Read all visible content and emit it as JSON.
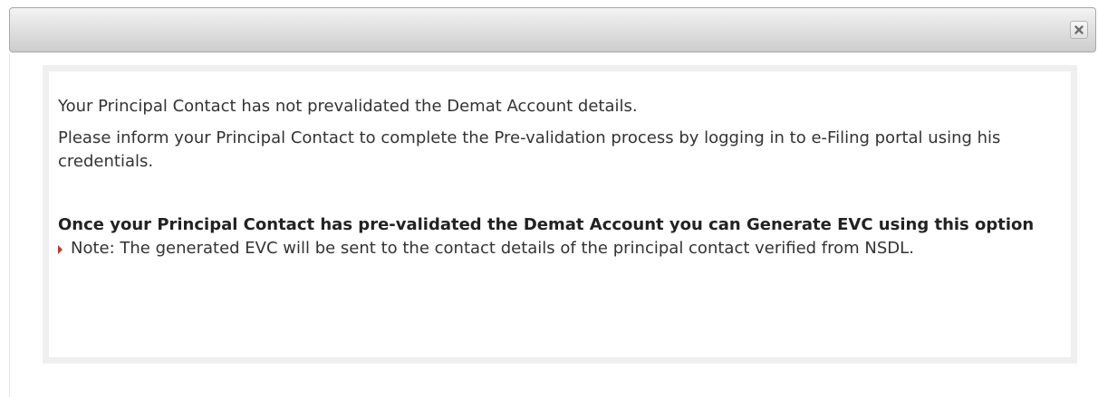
{
  "dialog": {
    "close_symbol": "×",
    "close_icon": "close-icon"
  },
  "message": {
    "line1": "Your Principal Contact has not prevalidated the Demat Account details.",
    "line2": "Please inform your Principal Contact to complete the Pre-validation process by logging in to e-Filing portal using his credentials.",
    "heading": "Once your Principal Contact has pre-validated the Demat Account you can Generate EVC using this option",
    "note": "Note: The generated EVC will be sent to the contact details of the principal contact verified from NSDL."
  },
  "colors": {
    "arrow": "#c0392b",
    "text": "#333333"
  }
}
